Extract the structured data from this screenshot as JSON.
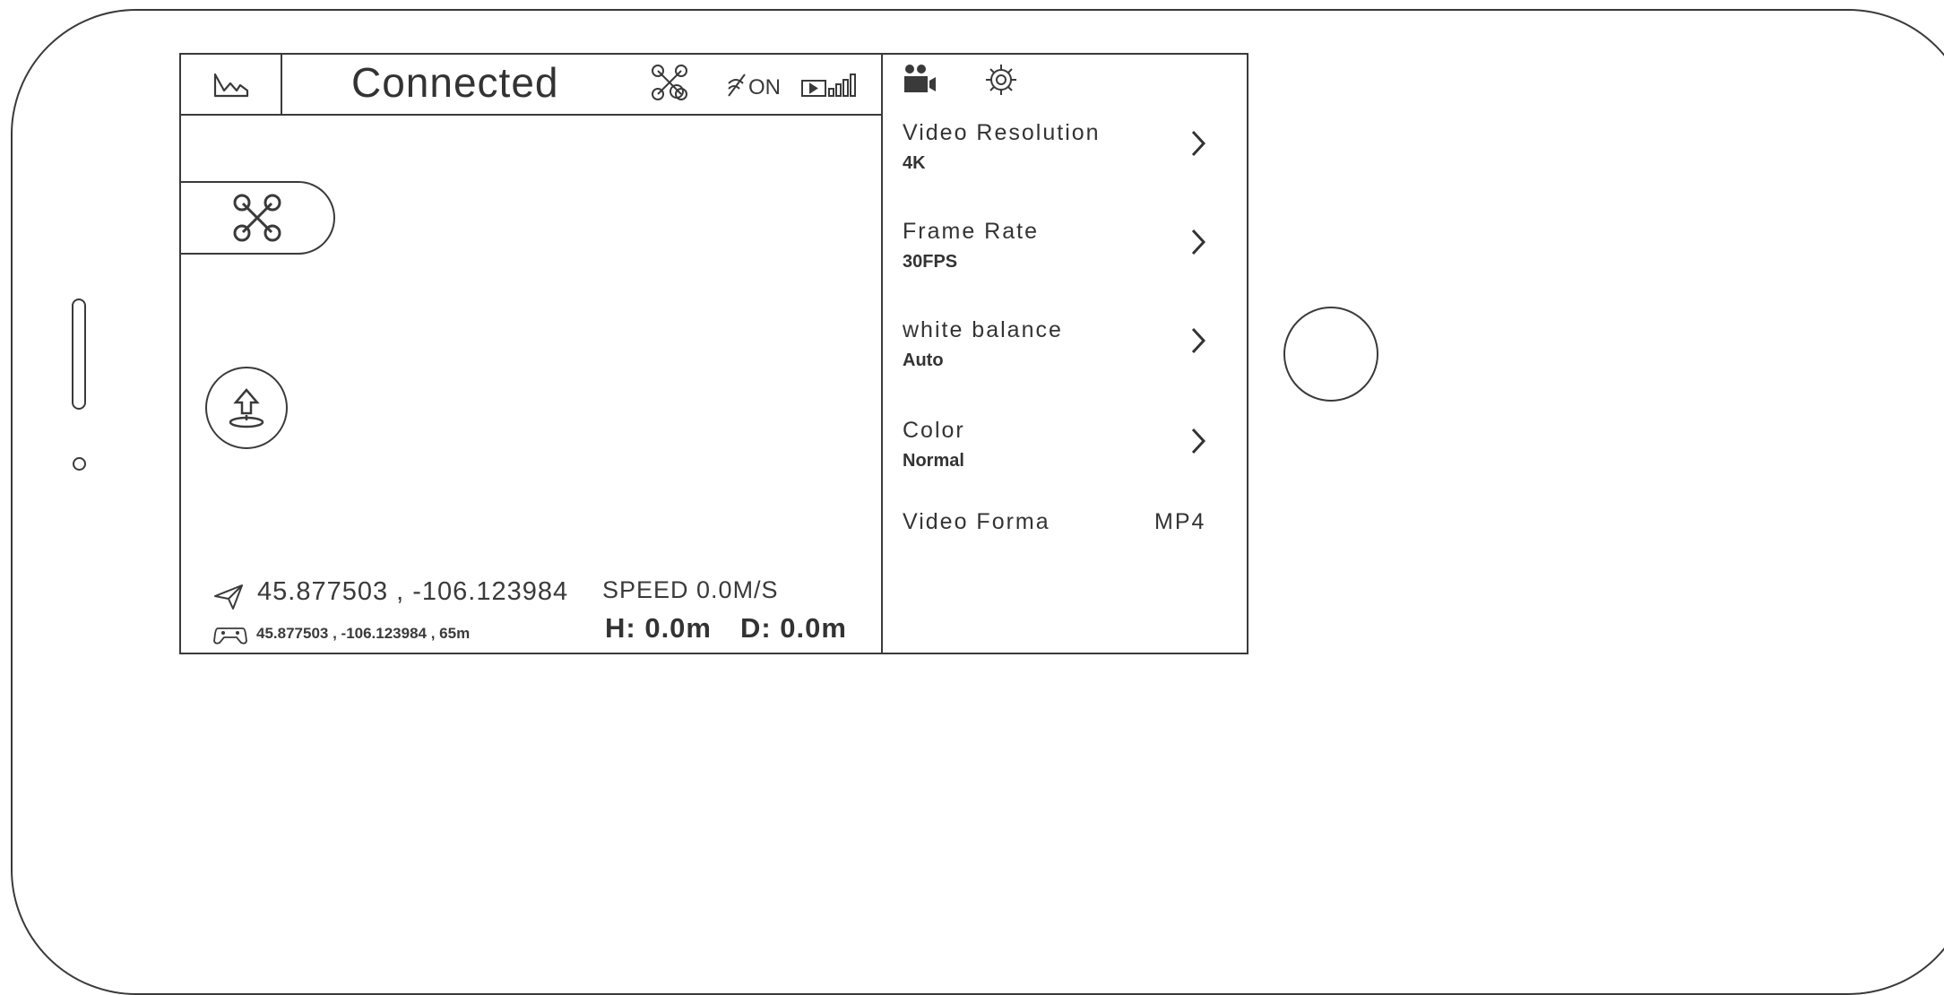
{
  "status_bar": {
    "connection_status": "Connected",
    "icons": [
      "map-icon",
      "drone-link-icon",
      "gps-off-on-icon",
      "signal-strength-icon"
    ],
    "gps_label": "ON"
  },
  "controls": {
    "icons": [
      "drone-icon",
      "takeoff-icon"
    ]
  },
  "telemetry": {
    "aircraft_coords": "45.877503 , -106.123984",
    "speed": "SPEED 0.0M/S",
    "controller_coords": "45.877503 , -106.123984 , 65m",
    "height": "H: 0.0m",
    "distance": "D: 0.0m"
  },
  "settings_panel": {
    "tabs": [
      "video-camera-icon",
      "settings-gear-icon"
    ],
    "items": [
      {
        "label": "Video Resolution",
        "value": "4K"
      },
      {
        "label": "Frame Rate",
        "value": "30FPS"
      },
      {
        "label": "white balance",
        "value": "Auto"
      },
      {
        "label": "Color",
        "value": "Normal"
      }
    ],
    "format": {
      "label": "Video Forma",
      "value": "MP4"
    }
  },
  "colors": {
    "line": "#3a3a3a",
    "background": "#ffffff"
  }
}
